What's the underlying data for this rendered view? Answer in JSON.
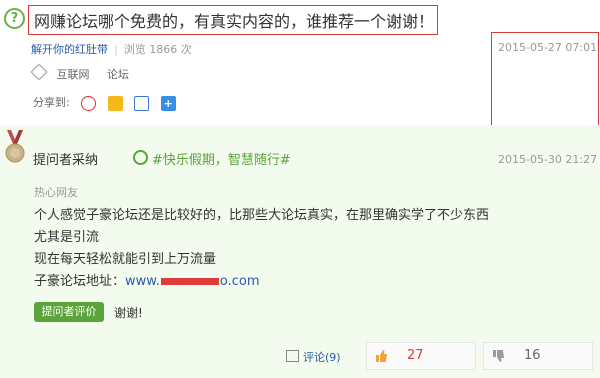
{
  "question": {
    "title": "网赚论坛哪个免费的，有真实内容的，谁推荐一个谢谢！",
    "author": "解开你的红肚带",
    "views": "浏览 1866 次",
    "date": "2015-05-27 07:01",
    "tags": [
      "互联网",
      "论坛"
    ],
    "share_label": "分享到:"
  },
  "answer": {
    "adopt_label": "提问者采纳",
    "slogan": "#快乐假期，智慧随行#",
    "date": "2015-05-30 21:27",
    "author": "热心网友",
    "lines": [
      "个人感觉子豪论坛还是比较好的，比那些大论坛真实，在那里确实学了不少东西",
      "尤其是引流",
      "现在每天轻松就能引到上万流量"
    ],
    "url_label": "子豪论坛地址：",
    "url_prefix": "www.",
    "url_suffix": "o.com",
    "eval_button": "提问者评价",
    "eval_text": "谢谢!",
    "comment": "评论(9)",
    "upvotes": "27",
    "downvotes": "16"
  },
  "colors": {
    "accent_green": "#5aa43a",
    "link_blue": "#2b5ca9",
    "highlight_red": "#d93a3a"
  }
}
